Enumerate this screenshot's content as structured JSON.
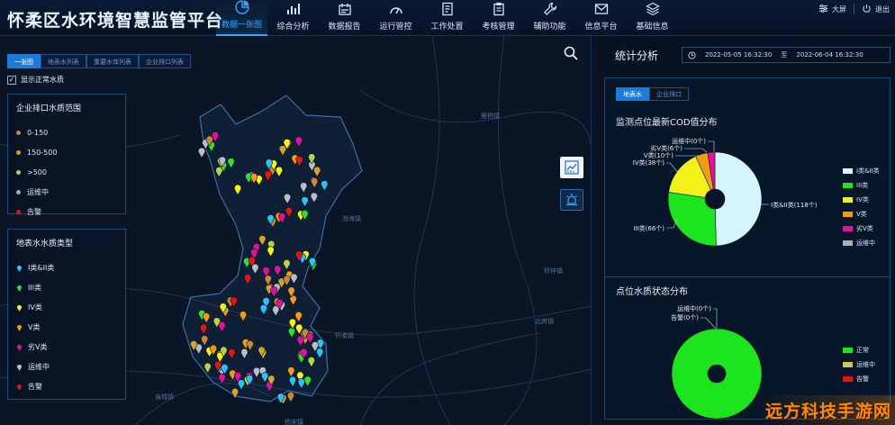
{
  "app": {
    "title": "怀柔区水环境智慧监管平台"
  },
  "nav": {
    "items": [
      {
        "label": "数据一张图",
        "icon": "pie-chart-icon",
        "active": true
      },
      {
        "label": "综合分析",
        "icon": "bar-chart-icon"
      },
      {
        "label": "数据报告",
        "icon": "report-icon"
      },
      {
        "label": "运行管控",
        "icon": "gauge-icon"
      },
      {
        "label": "工作处置",
        "icon": "task-icon"
      },
      {
        "label": "考核管理",
        "icon": "clipboard-icon"
      },
      {
        "label": "辅助功能",
        "icon": "wrench-icon"
      },
      {
        "label": "信息平台",
        "icon": "mail-icon"
      },
      {
        "label": "基础信息",
        "icon": "layers-icon"
      }
    ],
    "big_screen": "大屏",
    "logout": "退出"
  },
  "map": {
    "tabs": [
      "一张图",
      "地表水列表",
      "重要水体列表",
      "企业排口列表"
    ],
    "checkbox_label": "显示正常水质",
    "enterprise_legend": {
      "title": "企业排口水质范围",
      "items": [
        {
          "label": "0-150",
          "color": "#c08a3a"
        },
        {
          "label": "150-500",
          "color": "#d6a12c"
        },
        {
          "label": ">500",
          "color": "#b7d34a"
        },
        {
          "label": "运维中",
          "color": "#a7adb5"
        },
        {
          "label": "告警",
          "color": "#e01616"
        }
      ]
    },
    "surface_legend": {
      "title": "地表水水质类型",
      "items": [
        {
          "label": "I类&II类",
          "color": "#27c4f5"
        },
        {
          "label": "III类",
          "color": "#2ee12e"
        },
        {
          "label": "IV类",
          "color": "#f5f21a"
        },
        {
          "label": "V类",
          "color": "#f39c12"
        },
        {
          "label": "劣V类",
          "color": "#e0129b"
        },
        {
          "label": "运维中",
          "color": "#b8bec6"
        },
        {
          "label": "告警",
          "color": "#e01616"
        }
      ]
    },
    "place_labels": [
      "雁栖镇",
      "渤海镇",
      "桥梓镇",
      "怀柔镇",
      "北房镇",
      "庙城镇",
      "杨宋镇"
    ]
  },
  "panel": {
    "title": "统计分析",
    "date_start": "2022-05-05 16:32:30",
    "date_sep": "至",
    "date_end": "2022-06-04 16:32:30",
    "sub_tabs": [
      "地表水",
      "企业排口"
    ],
    "chart1_title": "监测点位最新COD值分布",
    "chart2_title": "点位水质状态分布"
  },
  "chart_data": [
    {
      "type": "pie",
      "title": "监测点位最新COD值分布",
      "categories": [
        "I类&II类",
        "III类",
        "IV类",
        "V类",
        "劣V类",
        "运维中"
      ],
      "values": [
        118,
        66,
        38,
        10,
        6,
        0
      ],
      "slice_labels": [
        "I类&II类(118个)",
        "III类(66个)",
        "IV类(38个)",
        "V类(10个)",
        "劣V类(6个)",
        "运维中(0个)"
      ],
      "colors": [
        "#d4f6ff",
        "#1de51d",
        "#f2f21b",
        "#f39c12",
        "#e0129b",
        "#a8b0b8"
      ],
      "legend": "right"
    },
    {
      "type": "pie",
      "title": "点位水质状态分布",
      "categories": [
        "正常",
        "运维中",
        "告警"
      ],
      "values": [
        238,
        0,
        0
      ],
      "slice_labels": [
        "",
        "运维中(0个)",
        "告警(0个)"
      ],
      "colors": [
        "#1de51d",
        "#c9c95a",
        "#e01616"
      ],
      "legend": "right"
    }
  ]
}
